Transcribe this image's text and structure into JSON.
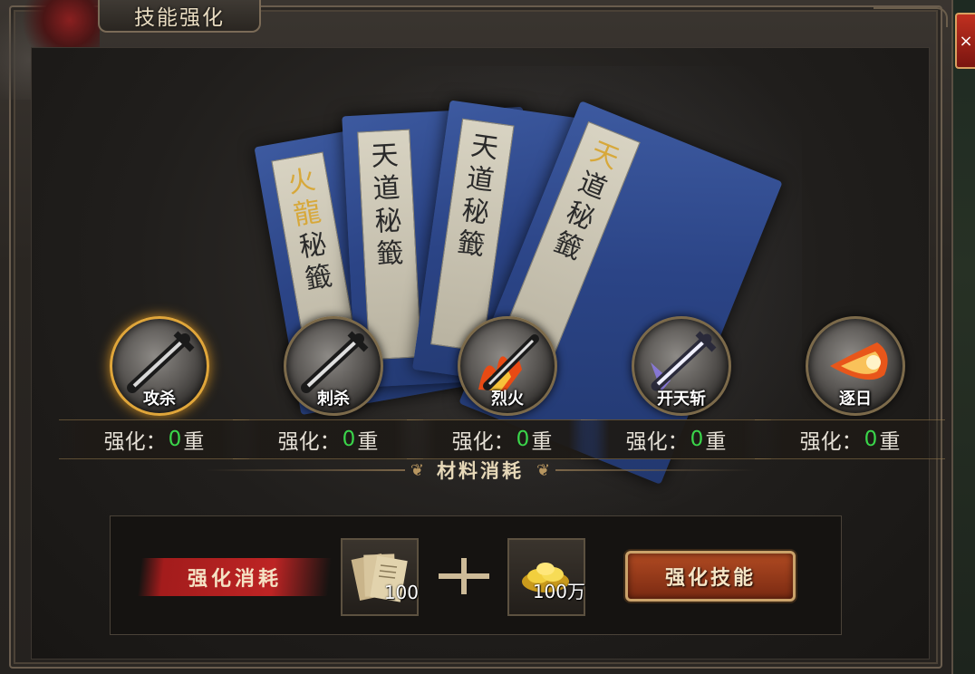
{
  "window": {
    "title": "技能强化",
    "close_label": "×"
  },
  "books": [
    {
      "text": "火龍秘籤"
    },
    {
      "text": "天道秘籤"
    },
    {
      "text": "天道秘籤"
    },
    {
      "text": "天道秘籤"
    }
  ],
  "skills": [
    {
      "name": "攻杀",
      "level_label": "强化：",
      "level": "0",
      "level_suffix": "重",
      "selected": true,
      "icon": "sword-icon"
    },
    {
      "name": "刺杀",
      "level_label": "强化：",
      "level": "0",
      "level_suffix": "重",
      "selected": false,
      "icon": "sword-icon"
    },
    {
      "name": "烈火",
      "level_label": "强化：",
      "level": "0",
      "level_suffix": "重",
      "selected": false,
      "icon": "flaming-sword-icon"
    },
    {
      "name": "开天斩",
      "level_label": "强化：",
      "level": "0",
      "level_suffix": "重",
      "selected": false,
      "icon": "lightning-sword-icon"
    },
    {
      "name": "逐日",
      "level_label": "强化：",
      "level": "0",
      "level_suffix": "重",
      "selected": false,
      "icon": "fireball-icon"
    }
  ],
  "materials": {
    "header": "材料消耗",
    "cost_label": "强化消耗",
    "item1": {
      "icon": "scroll-pages-icon",
      "quantity": "100"
    },
    "item2": {
      "icon": "gold-ingot-icon",
      "quantity": "100万"
    },
    "plus_icon": "plus-icon",
    "enhance_button": "强化技能"
  },
  "colors": {
    "level_number": "#3ad54a",
    "enhance_button": "#b04a22",
    "cost_label_bg": "#bd2424",
    "book_blue": "#2b4486"
  }
}
